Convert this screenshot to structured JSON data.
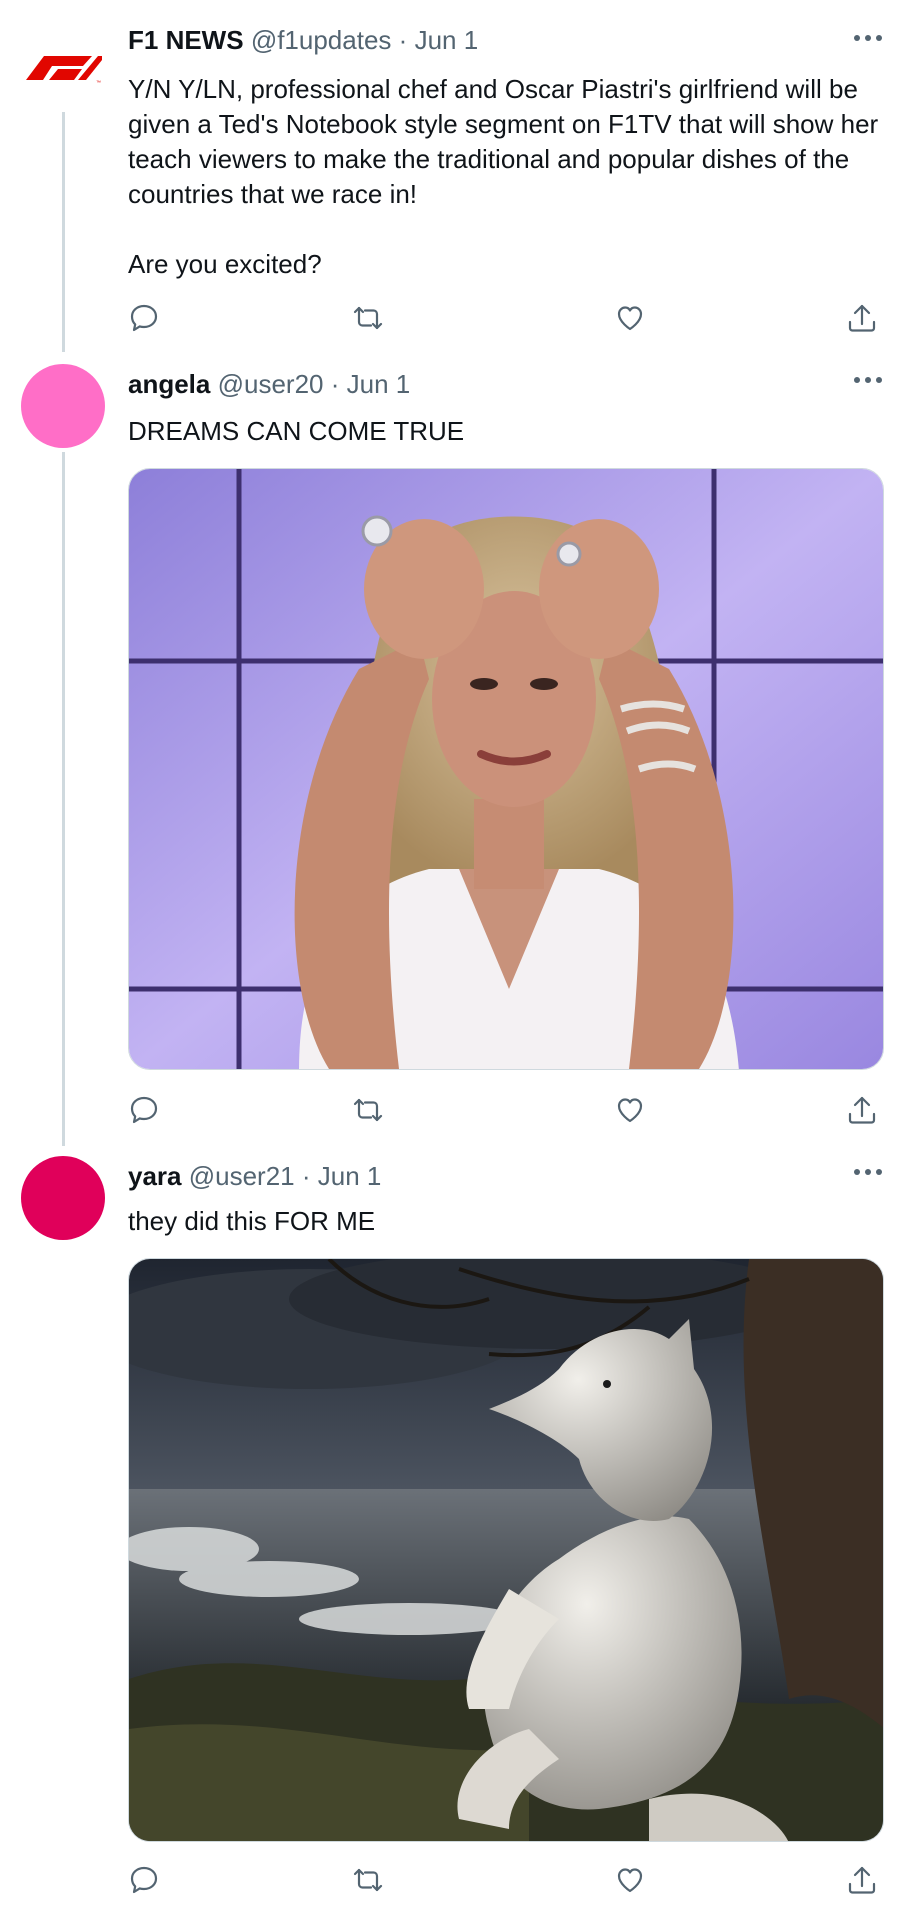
{
  "tweets": [
    {
      "name": "F1 NEWS",
      "handle": "@f1updates",
      "date": "Jun 1",
      "text_lines": [
        "Y/N Y/LN, professional chef and Oscar Piastri's girlfriend will be given a Ted's Notebook style segment on F1TV that will show her teach viewers to make the traditional and popular dishes of the countries that we race in!",
        "Are you excited?"
      ],
      "avatar": "f1-logo",
      "avatar_color": "#e10600"
    },
    {
      "name": "angela",
      "handle": "@user20",
      "date": "Jun 1",
      "text_lines": [
        "DREAMS CAN COME TRUE"
      ],
      "avatar_color": "#ff6ec7",
      "media": "photo-woman-hands-on-head"
    },
    {
      "name": "yara",
      "handle": "@user21",
      "date": "Jun 1",
      "text_lines": [
        "they did this FOR ME"
      ],
      "avatar_color": "#e0005a",
      "media": "illustration-wolf-stormy-sea"
    }
  ],
  "separator": "·",
  "icons": [
    "reply-icon",
    "retweet-icon",
    "like-icon",
    "share-icon",
    "more-icon"
  ],
  "colors": {
    "text": "#0f1419",
    "muted": "#536471",
    "border": "#cfd9de"
  }
}
